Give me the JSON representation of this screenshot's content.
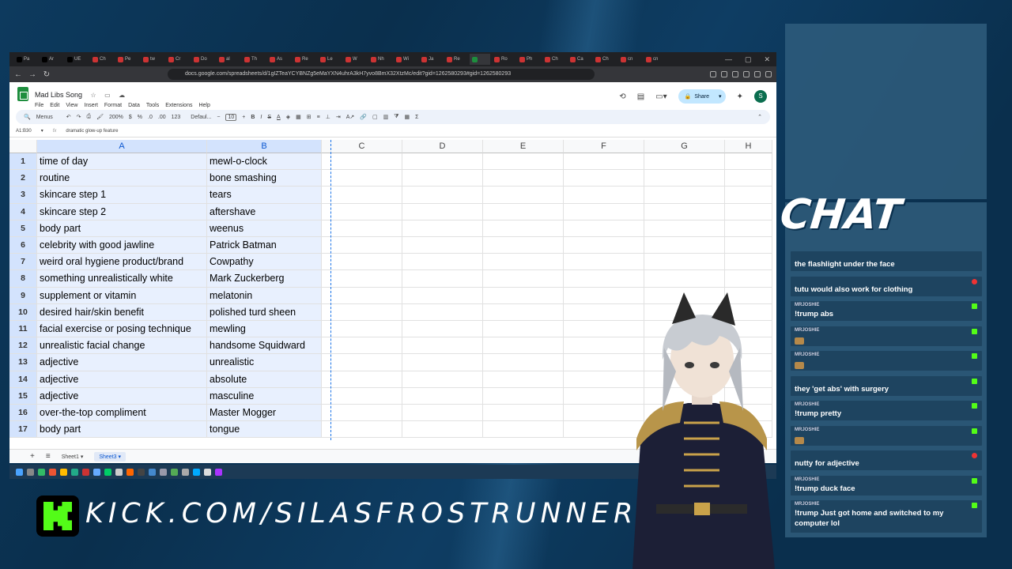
{
  "browser": {
    "tabs": [
      "Pa",
      "Ar",
      "UE",
      "Ch",
      "Pe",
      "tw",
      "Cr",
      "Do",
      "al",
      "Th",
      "As",
      "Re",
      "Le",
      "W",
      "Nh",
      "Wi",
      "Ja",
      "Re",
      "",
      "Ro",
      "Ph",
      "Ch",
      "Ca",
      "Ch",
      "cn",
      "cn"
    ],
    "url": "docs.google.com/spreadsheets/d/1gIZTeaYCYBNZg5eMaYXN4uhrA3kH7yvo8BmX32XtzMc/edit?gid=1262580293#gid=1262580293"
  },
  "sheets": {
    "title": "Mad Libs Song",
    "menu": [
      "File",
      "Edit",
      "View",
      "Insert",
      "Format",
      "Data",
      "Tools",
      "Extensions",
      "Help"
    ],
    "share_label": "Share",
    "avatar_letter": "S",
    "toolbar": {
      "menus_label": "Menus",
      "zoom": "200%",
      "currency": "$",
      "percent": "%",
      "decimals_dec": ".0",
      "decimals_inc": ".00",
      "number_format": "123",
      "font": "Defaul...",
      "font_size": "10",
      "sum_icon": "Σ"
    },
    "name_box": "A1:B30",
    "formula": "dramatic glow-up feature",
    "columns": [
      "A",
      "B",
      "C",
      "D",
      "E",
      "F",
      "G",
      "H"
    ],
    "rows": [
      {
        "n": "1",
        "a": "time of day",
        "b": "mewl-o-clock"
      },
      {
        "n": "2",
        "a": "routine",
        "b": "bone smashing"
      },
      {
        "n": "3",
        "a": "skincare step 1",
        "b": "tears"
      },
      {
        "n": "4",
        "a": "skincare step 2",
        "b": "aftershave"
      },
      {
        "n": "5",
        "a": "body part",
        "b": "weenus"
      },
      {
        "n": "6",
        "a": "celebrity with good jawline",
        "b": "Patrick Batman"
      },
      {
        "n": "7",
        "a": "weird oral hygiene product/brand",
        "b": "Cowpathy"
      },
      {
        "n": "8",
        "a": "something unrealistically white",
        "b": "Mark Zuckerberg"
      },
      {
        "n": "9",
        "a": "supplement or vitamin",
        "b": "melatonin"
      },
      {
        "n": "10",
        "a": "desired hair/skin benefit",
        "b": "polished turd sheen"
      },
      {
        "n": "11",
        "a": "facial exercise or posing technique",
        "b": "mewling"
      },
      {
        "n": "12",
        "a": "unrealistic facial change",
        "b": "handsome Squidward"
      },
      {
        "n": "13",
        "a": "adjective",
        "b": "unrealistic"
      },
      {
        "n": "14",
        "a": "adjective",
        "b": "absolute"
      },
      {
        "n": "15",
        "a": "adjective",
        "b": "masculine"
      },
      {
        "n": "16",
        "a": "over-the-top compliment",
        "b": "Master Mogger"
      },
      {
        "n": "17",
        "a": "body part",
        "b": "tongue"
      }
    ],
    "sheet_tabs": [
      "Sheet1",
      "Sheet3"
    ],
    "add_sheet": "+",
    "all_sheets": "≡"
  },
  "stream": {
    "kick_url": "KICK.COM/SILASFROSTRUNNER",
    "chat_title": "CHAT",
    "messages": [
      {
        "user": "",
        "text": "the flashlight under the face",
        "color": "blue",
        "badge": ""
      },
      {
        "user": "",
        "text": "tutu would also work for clothing",
        "color": "green",
        "badge": "red"
      },
      {
        "user": "MRJOSHIE",
        "text": "!trump abs",
        "color": "",
        "badge": "green"
      },
      {
        "user": "MRJOSHIE",
        "text": "",
        "color": "",
        "badge": "green",
        "emote": true
      },
      {
        "user": "MRJOSHIE",
        "text": "",
        "color": "",
        "badge": "green",
        "emote": true
      },
      {
        "user": "",
        "text": "they 'get abs' with surgery",
        "color": "blue",
        "badge": "green"
      },
      {
        "user": "MRJOSHIE",
        "text": "!trump pretty",
        "color": "",
        "badge": "green"
      },
      {
        "user": "MRJOSHIE",
        "text": "",
        "color": "",
        "badge": "green",
        "emote": true
      },
      {
        "user": "",
        "text": "nutty for adjective",
        "color": "green",
        "badge": "red"
      },
      {
        "user": "MRJOSHIE",
        "text": "!trump duck face",
        "color": "",
        "badge": "green"
      },
      {
        "user": "MRJOSHIE",
        "text": "!trump Just got home and switched to my computer lol",
        "color": "",
        "badge": "green"
      }
    ]
  },
  "colors": {
    "background": "#0a2f4d",
    "kick_green": "#53fc18",
    "sheets_green": "#1e8e3e",
    "selection_blue": "#1a73e8"
  }
}
